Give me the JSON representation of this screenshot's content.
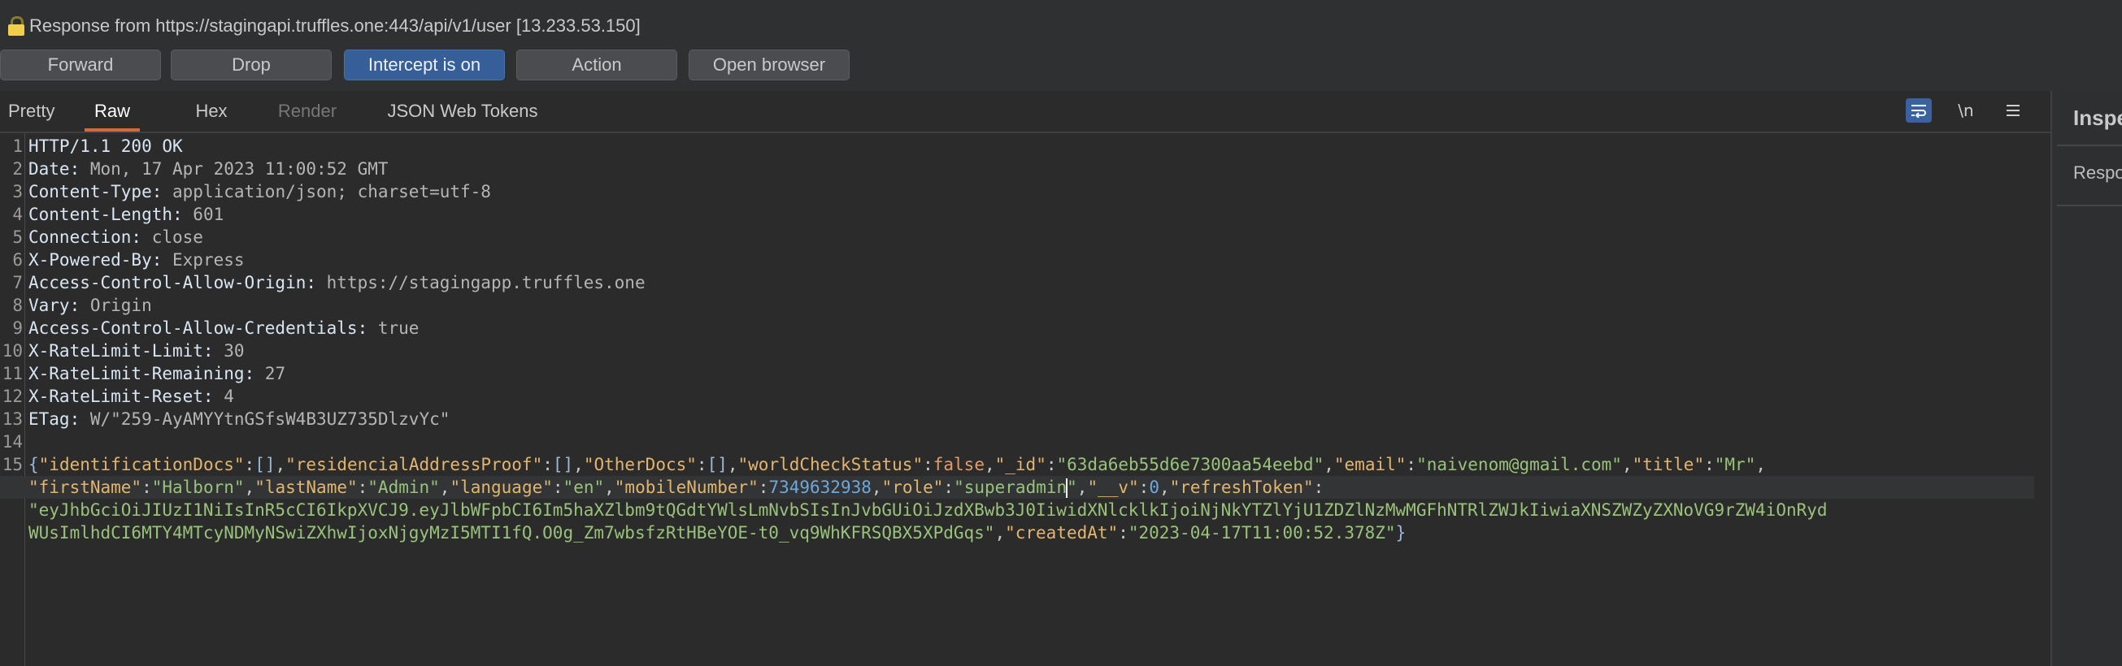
{
  "title": {
    "icon": "lock-icon",
    "text": "Response from https://stagingapi.truffles.one:443/api/v1/user  [13.233.53.150]"
  },
  "toolbar": {
    "buttons": [
      {
        "label": "Forward",
        "active": false
      },
      {
        "label": "Drop",
        "active": false
      },
      {
        "label": "Intercept is on",
        "active": true
      },
      {
        "label": "Action",
        "active": false
      },
      {
        "label": "Open browser",
        "active": false
      }
    ]
  },
  "tabs": [
    {
      "label": "Pretty",
      "state": "normal"
    },
    {
      "label": "Raw",
      "state": "active"
    },
    {
      "label": "Hex",
      "state": "normal"
    },
    {
      "label": "Render",
      "state": "disabled"
    },
    {
      "label": "JSON Web Tokens",
      "state": "normal"
    }
  ],
  "tab_tools": {
    "wrap_icon": "word-wrap-icon",
    "newline_label": "\\n",
    "menu_icon": "hamburger-menu-icon"
  },
  "inspector": {
    "title": "Inspector",
    "section": "Response"
  },
  "colors": {
    "accent": "#d4693b",
    "intercept_on": "#365f99",
    "json_key": "#e3b56c",
    "json_string": "#98c379",
    "json_number": "#6fa8dc",
    "json_bool": "#e39b6a"
  },
  "response": {
    "status_line": "HTTP/1.1 200 OK",
    "headers": [
      {
        "name": "Date",
        "value": "Mon, 17 Apr 2023 11:00:52 GMT"
      },
      {
        "name": "Content-Type",
        "value": "application/json; charset=utf-8"
      },
      {
        "name": "Content-Length",
        "value": "601"
      },
      {
        "name": "Connection",
        "value": "close"
      },
      {
        "name": "X-Powered-By",
        "value": "Express"
      },
      {
        "name": "Access-Control-Allow-Origin",
        "value": "https://stagingapp.truffles.one"
      },
      {
        "name": "Vary",
        "value": "Origin"
      },
      {
        "name": "Access-Control-Allow-Credentials",
        "value": "true"
      },
      {
        "name": "X-RateLimit-Limit",
        "value": "30"
      },
      {
        "name": "X-RateLimit-Remaining",
        "value": "27"
      },
      {
        "name": "X-RateLimit-Reset",
        "value": "4"
      },
      {
        "name": "ETag",
        "value": "W/\"259-AyAMYYtnGSfsW4B3UZ735DlzvYc\""
      }
    ],
    "body_line_number": "15",
    "body_rows": [
      [
        [
          "jbr",
          "{"
        ],
        [
          "jk",
          "\"identificationDocs\""
        ],
        [
          "jp",
          ":"
        ],
        [
          "jbr",
          "[]"
        ],
        [
          "jp",
          ","
        ],
        [
          "jk",
          "\"residencialAddressProof\""
        ],
        [
          "jp",
          ":"
        ],
        [
          "jbr",
          "[]"
        ],
        [
          "jp",
          ","
        ],
        [
          "jk",
          "\"OtherDocs\""
        ],
        [
          "jp",
          ":"
        ],
        [
          "jbr",
          "[]"
        ],
        [
          "jp",
          ","
        ],
        [
          "jk",
          "\"worldCheckStatus\""
        ],
        [
          "jp",
          ":"
        ],
        [
          "jb",
          "false"
        ],
        [
          "jp",
          ","
        ],
        [
          "jk",
          "\"_id\""
        ],
        [
          "jp",
          ":"
        ],
        [
          "js",
          "\"63da6eb55d6e7300aa54eebd\""
        ],
        [
          "jp",
          ","
        ],
        [
          "jk",
          "\"email\""
        ],
        [
          "jp",
          ":"
        ],
        [
          "js",
          "\"naivenom@gmail.com\""
        ],
        [
          "jp",
          ","
        ],
        [
          "jk",
          "\"title\""
        ],
        [
          "jp",
          ":"
        ],
        [
          "js",
          "\"Mr\""
        ],
        [
          "jp",
          ","
        ]
      ],
      [
        [
          "jk",
          "\"firstName\""
        ],
        [
          "jp",
          ":"
        ],
        [
          "js",
          "\"Halborn\""
        ],
        [
          "jp",
          ","
        ],
        [
          "jk",
          "\"lastName\""
        ],
        [
          "jp",
          ":"
        ],
        [
          "js",
          "\"Admin\""
        ],
        [
          "jp",
          ","
        ],
        [
          "jk",
          "\"language\""
        ],
        [
          "jp",
          ":"
        ],
        [
          "js",
          "\"en\""
        ],
        [
          "jp",
          ","
        ],
        [
          "jk",
          "\"mobileNumber\""
        ],
        [
          "jp",
          ":"
        ],
        [
          "jn",
          "7349632938"
        ],
        [
          "jp",
          ","
        ],
        [
          "jk",
          "\"role\""
        ],
        [
          "jp",
          ":"
        ],
        [
          "js",
          "\"superadmin"
        ],
        [
          "caret",
          ""
        ],
        [
          "js",
          "\""
        ],
        [
          "jp",
          ","
        ],
        [
          "jk",
          "\"__v\""
        ],
        [
          "jp",
          ":"
        ],
        [
          "jn",
          "0"
        ],
        [
          "jp",
          ","
        ],
        [
          "jk",
          "\"refreshToken\""
        ],
        [
          "jp",
          ":"
        ]
      ],
      [
        [
          "js",
          "\"eyJhbGciOiJIUzI1NiIsInR5cCI6IkpXVCJ9.eyJlbWFpbCI6Im5haXZlbm9tQGdtYWlsLmNvbSIsInJvbGUiOiJzdXBwb3J0IiwidXNlcklkIjoiNjNkYTZlYjU1ZDZlNzMwMGFhNTRlZWJkIiwiaXNSZWZyZXNoVG9rZW4iOnRyd"
        ]
      ],
      [
        [
          "js",
          "WUsImlhdCI6MTY4MTcyNDMyNSwiZXhwIjoxNjgyMzI5MTI1fQ.O0g_Zm7wbsfzRtHBeYOE-t0_vq9WhKFRSQBX5XPdGqs\""
        ],
        [
          "jp",
          ","
        ],
        [
          "jk",
          "\"createdAt\""
        ],
        [
          "jp",
          ":"
        ],
        [
          "js",
          "\"2023-04-17T11:00:52.378Z\""
        ],
        [
          "jbr",
          "}"
        ]
      ]
    ]
  }
}
